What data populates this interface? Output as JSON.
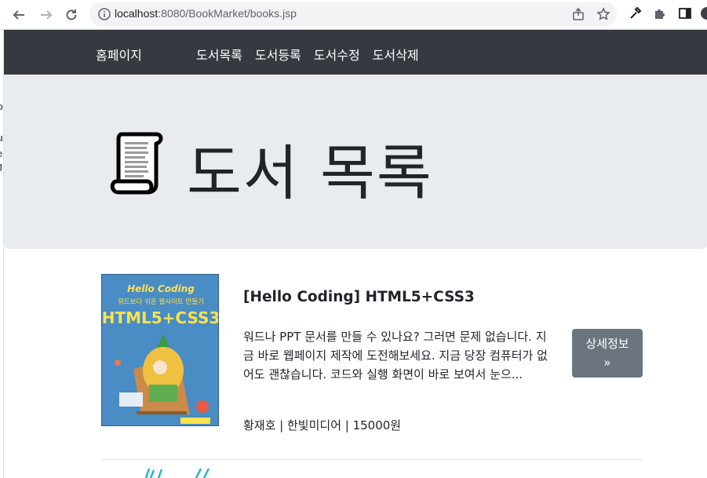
{
  "browser": {
    "url_host": "localhost",
    "url_path": ":8080/BookMarket/books.jsp"
  },
  "left_strip": [
    "o",
    "I",
    "u",
    "e",
    "J"
  ],
  "navbar": {
    "brand": "홈페이지",
    "items": [
      {
        "label": "도서목록"
      },
      {
        "label": "도서등록"
      },
      {
        "label": "도서수정"
      },
      {
        "label": "도서삭제"
      }
    ]
  },
  "jumbotron": {
    "title": "도서 목록",
    "icon": "scroll-icon"
  },
  "books": [
    {
      "title": "[Hello Coding] HTML5+CSS3",
      "description": "워드나 PPT 문서를 만들 수 있나요? 그러면 문제 없습니다. 지금 바로 웹페이지 제작에 도전해보세요. 지금 당장 컴퓨터가 없어도 괜찮습니다. 코드와 실행 화면이 바로 보여서 눈으...",
      "meta": "황재호 | 한빛미디어 | 15000원",
      "detail_label": "상세정보",
      "detail_arrow": "»",
      "cover": {
        "line1": "Hello Coding",
        "line2": "워드보다 쉬운 웹사이트 만들기",
        "line3": "HTML5+CSS3"
      }
    }
  ],
  "colors": {
    "navbar_bg": "#343a40",
    "jumbotron_bg": "#e9ecef",
    "button_bg": "#6c757d",
    "cover_bg": "#4a8cc4"
  }
}
